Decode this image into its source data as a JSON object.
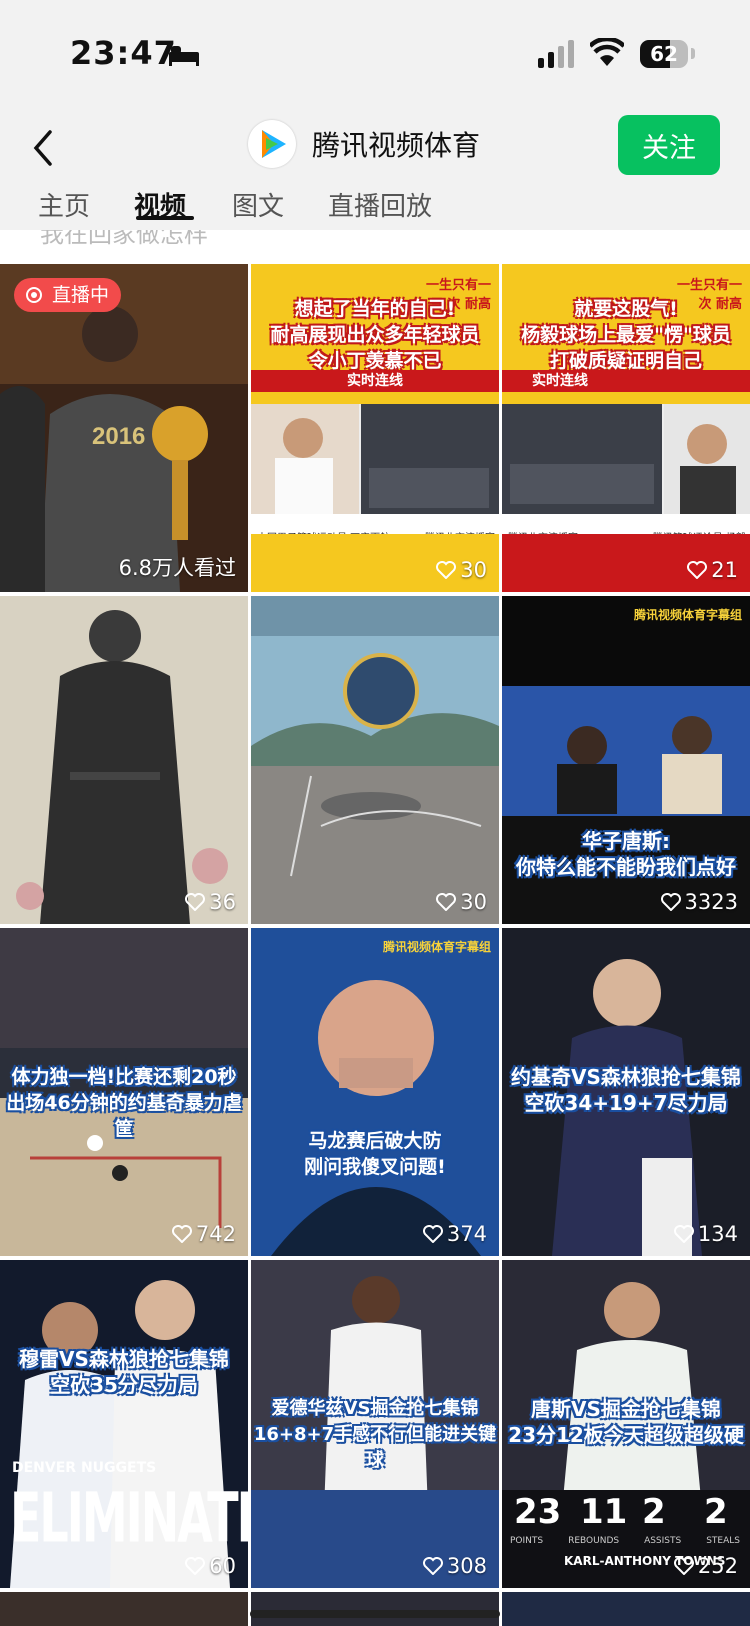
{
  "status": {
    "time": "23:47",
    "battery": "62",
    "battery_level": 0.62
  },
  "header": {
    "title": "腾讯视频体育",
    "follow_label": "关注"
  },
  "tabs": [
    {
      "label": "主页"
    },
    {
      "label": "视频"
    },
    {
      "label": "图文"
    },
    {
      "label": "直播回放"
    }
  ],
  "peek_text": "我在回家做怎样",
  "tiles": [
    {
      "live_label": "直播中",
      "count": "6.8万人看过"
    },
    {
      "top_right": "一生只有一次 耐高",
      "caption_lines": [
        "想起了当年的自己!",
        "耐高展现出众多年轻球员",
        "令小丁羡慕不已"
      ],
      "sub_label": "实时连线",
      "left_name": "中国男子篮球运动员 丁彦雨航",
      "right_name": "腾讯北京演播室",
      "count": "30"
    },
    {
      "top_right": "一生只有一次 耐高",
      "caption_lines": [
        "就要这股气!",
        "杨毅球场上最爱\"愣\"球员",
        "打破质疑证明自己"
      ],
      "sub_label": "实时连线",
      "left_name": "腾讯北京演播室",
      "right_name": "腾讯篮球评论员 杨毅",
      "count": "21"
    },
    {
      "count": "36"
    },
    {
      "count": "30"
    },
    {
      "tag": "腾讯视频体育字幕组",
      "caption_lines": [
        "华子唐斯:",
        "你特么能不能盼我们点好"
      ],
      "count": "3323"
    },
    {
      "caption_lines": [
        "体力独一档!比赛还剩20秒",
        "出场46分钟的约基奇暴力虐筐"
      ],
      "count": "742"
    },
    {
      "tag": "腾讯视频体育字幕组",
      "caption_lines": [
        "马龙赛后破大防",
        "刚问我傻叉问题!"
      ],
      "count": "374"
    },
    {
      "caption_lines": [
        "约基奇VS森林狼抢七集锦",
        "空砍34+19+7尽力局"
      ],
      "count": "134"
    },
    {
      "caption_lines": [
        "穆雷VS森林狼抢七集锦",
        "空砍35分尽力局"
      ],
      "elim_top": "DENVER NUGGETS",
      "elim": "ELIMINATED",
      "count": "60"
    },
    {
      "caption_lines": [
        "爱德华兹VS掘金抢七集锦",
        "16+8+7手感不行但能进关键球"
      ],
      "count": "308"
    },
    {
      "caption_lines": [
        "唐斯VS掘金抢七集锦",
        "23分12板今天超级超级硬"
      ],
      "stats": [
        "23",
        "11",
        "2",
        "2"
      ],
      "stat_labels": [
        "POINTS",
        "REBOUNDS",
        "ASSISTS",
        "STEALS"
      ],
      "player": "KARL-ANTHONY TOWNS",
      "count": "252"
    }
  ],
  "colors": {
    "accent_green": "#07c160",
    "live_red": "#f24b4b"
  }
}
